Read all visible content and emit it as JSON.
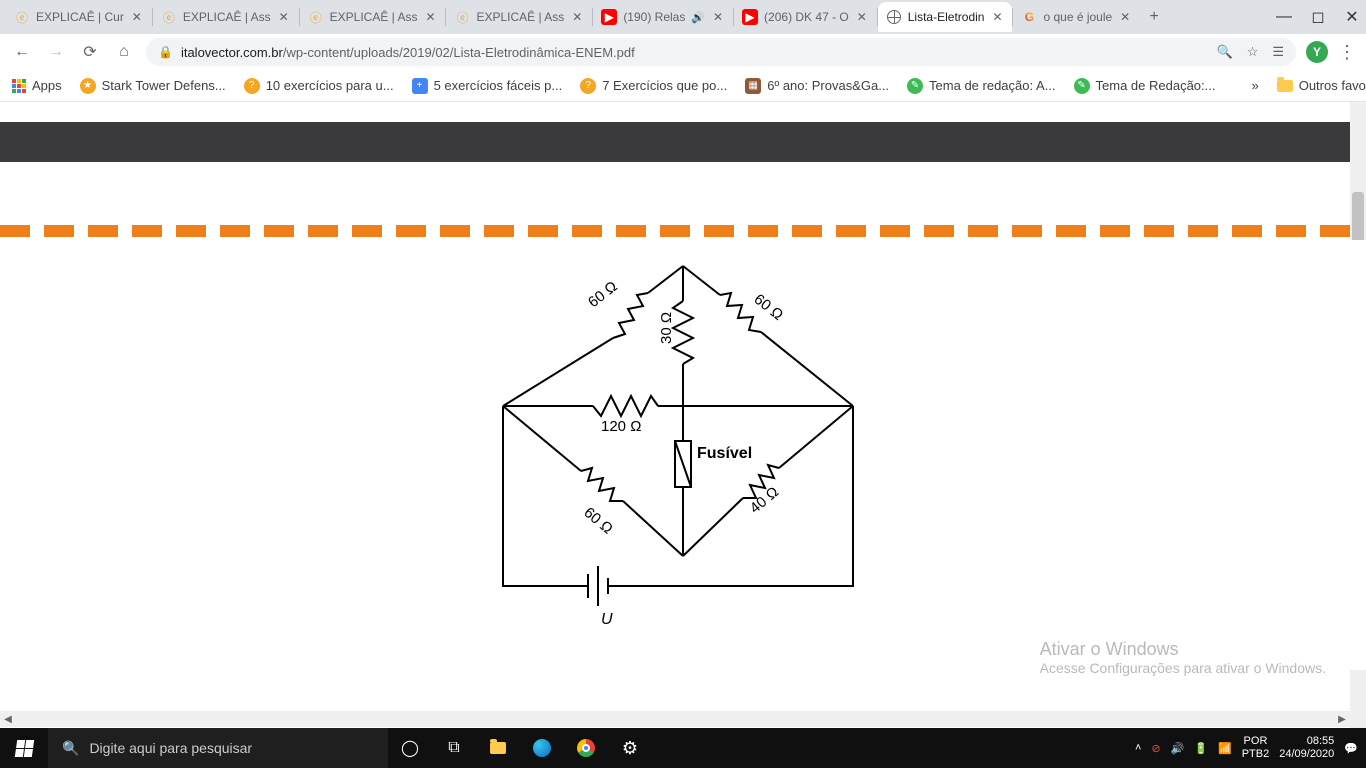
{
  "tabs": [
    {
      "title": "EXPLICAÊ | Cur",
      "icon": "explicae"
    },
    {
      "title": "EXPLICAÊ | Ass",
      "icon": "explicae"
    },
    {
      "title": "EXPLICAÊ | Ass",
      "icon": "explicae"
    },
    {
      "title": "EXPLICAÊ | Ass",
      "icon": "explicae"
    },
    {
      "title": "(190) Relas",
      "icon": "youtube",
      "audio": true
    },
    {
      "title": "(206) DK 47 - O",
      "icon": "youtube"
    },
    {
      "title": "Lista-Eletrodin",
      "icon": "globe",
      "active": true
    },
    {
      "title": "o que é joule",
      "icon": "google"
    }
  ],
  "url": {
    "host": "italovector.com.br",
    "path": "/wp-content/uploads/2019/02/Lista-Eletrodinâmica-ENEM.pdf"
  },
  "avatar_letter": "Y",
  "bookmarks": [
    {
      "label": "Apps",
      "icon": "apps"
    },
    {
      "label": "Stark Tower Defens...",
      "color": "#f5a623"
    },
    {
      "label": "10 exercícios para u...",
      "color": "#f5a623"
    },
    {
      "label": "5 exercícios fáceis p...",
      "color": "#4285f4"
    },
    {
      "label": "7 Exercícios que po...",
      "color": "#f5a623"
    },
    {
      "label": "6º ano: Provas&Ga...",
      "color": "#8e5a3a"
    },
    {
      "label": "Tema de redação: A...",
      "color": "#3cba54"
    },
    {
      "label": "Tema de Redação:...",
      "color": "#3cba54"
    }
  ],
  "bookmarks_overflow": "»",
  "other_bookmarks": "Outros favoritos",
  "circuit": {
    "r_top_left": "60 Ω",
    "r_top_right": "60 Ω",
    "r_middle_v": "30 Ω",
    "r_middle_h": "120 Ω",
    "r_bot_left": "60 Ω",
    "r_bot_right": "40 Ω",
    "fuse_label": "Fusível",
    "source_label": "U"
  },
  "watermark": {
    "l1": "Ativar o Windows",
    "l2": "Acesse Configurações para ativar o Windows."
  },
  "taskbar": {
    "search_placeholder": "Digite aqui para pesquisar",
    "lang1": "POR",
    "lang2": "PTB2",
    "time": "08:55",
    "date": "24/09/2020"
  }
}
